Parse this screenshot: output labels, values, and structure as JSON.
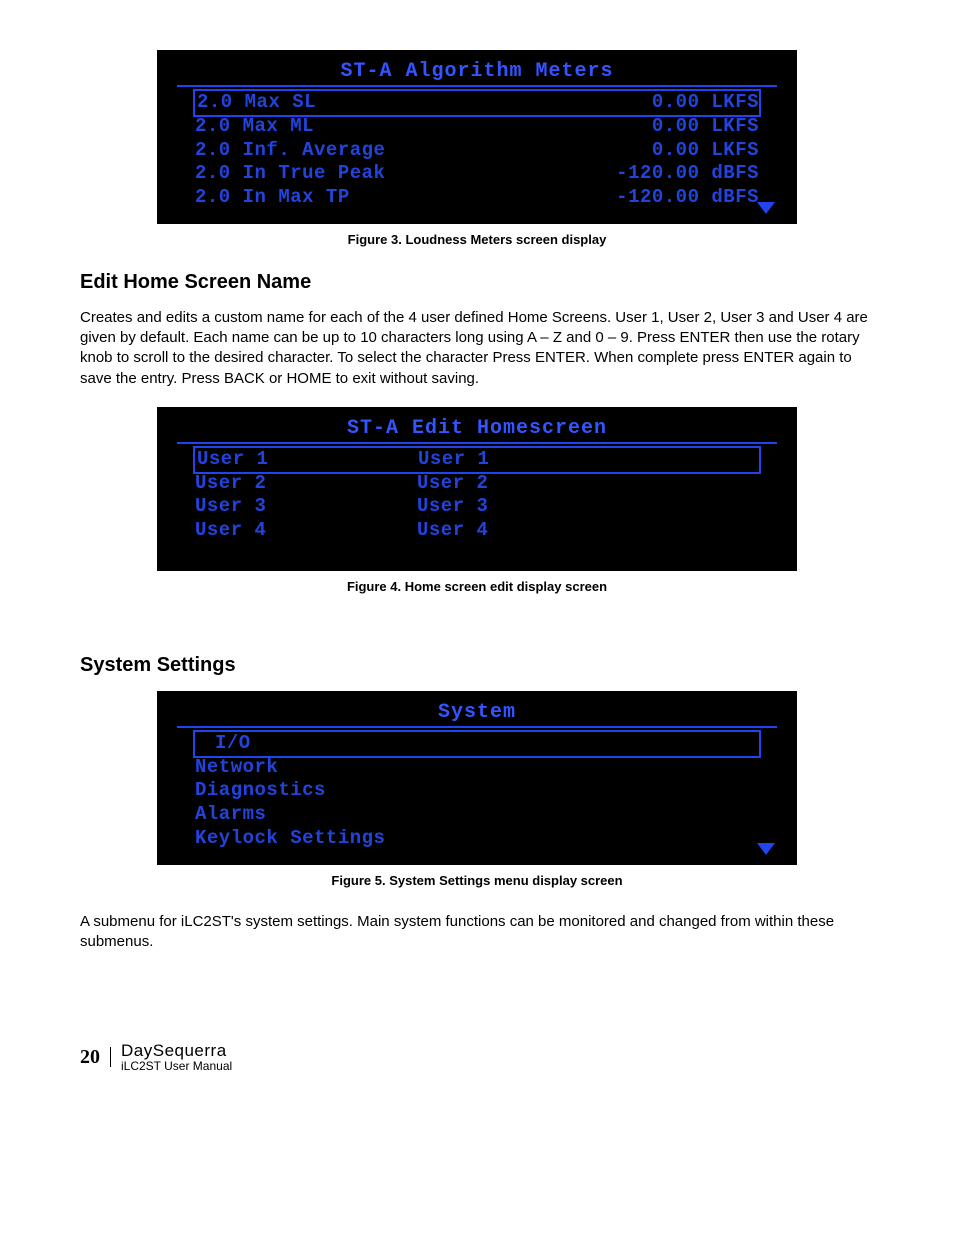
{
  "figure3": {
    "title": "ST-A Algorithm Meters",
    "rows": [
      {
        "label": "2.0 Max SL",
        "value": "0.00 LKFS",
        "selected": true
      },
      {
        "label": "2.0 Max ML",
        "value": "0.00 LKFS"
      },
      {
        "label": "2.0 Inf. Average",
        "value": "0.00 LKFS"
      },
      {
        "label": "2.0 In True Peak",
        "value": "-120.00 dBFS"
      },
      {
        "label": "2.0 In Max TP",
        "value": "-120.00 dBFS"
      }
    ],
    "caption": "Figure 3.  Loudness Meters screen display"
  },
  "sectionEdit": {
    "heading": "Edit Home Screen Name",
    "body": "Creates and edits a custom name for each of the 4 user defined Home Screens.  User 1, User 2, User 3 and User 4 are given by default.  Each name can be up to 10 characters long using A – Z and 0 – 9.  Press ENTER then use the rotary knob to scroll to the desired character.  To select the character Press ENTER.  When complete press ENTER again to save the entry.  Press BACK or HOME to exit without saving."
  },
  "figure4": {
    "title": "ST-A Edit Homescreen",
    "rows": [
      {
        "label": "User 1",
        "value": "User 1",
        "selected": true
      },
      {
        "label": "User 2",
        "value": "User 2"
      },
      {
        "label": "User 3",
        "value": "User 3"
      },
      {
        "label": "User 4",
        "value": "User 4"
      }
    ],
    "caption": "Figure 4.  Home screen edit display screen"
  },
  "sectionSystem": {
    "heading": "System Settings"
  },
  "figure5": {
    "title": "System",
    "rows": [
      {
        "label": "I/O",
        "selected": true
      },
      {
        "label": "Network"
      },
      {
        "label": "Diagnostics"
      },
      {
        "label": "Alarms"
      },
      {
        "label": "Keylock Settings"
      }
    ],
    "caption": "Figure 5.  System Settings menu display screen"
  },
  "sectionSystemBody": "A submenu for iLC2ST's system settings.  Main system functions can be monitored and changed from within these submenus.",
  "footer": {
    "page": "20",
    "brand": "DaySequerra",
    "manual": "iLC2ST User Manual"
  }
}
